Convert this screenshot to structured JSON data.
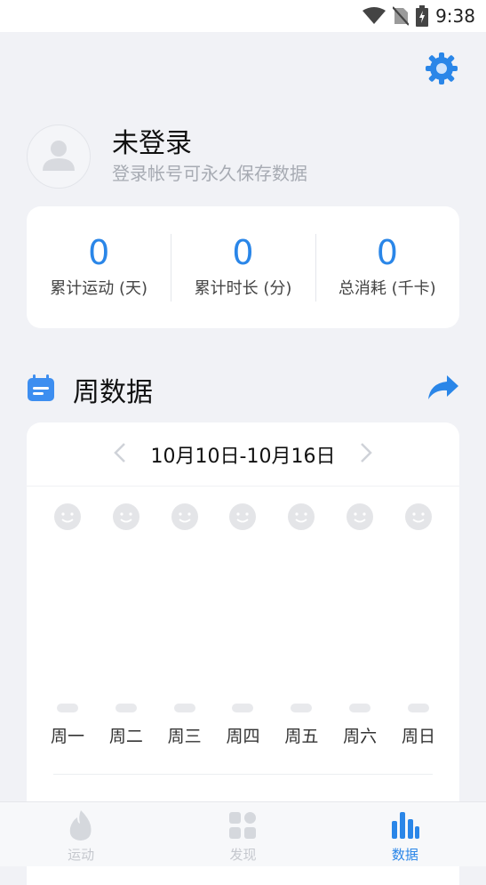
{
  "status_bar": {
    "time": "9:38",
    "icons": [
      "wifi-icon",
      "no-sim-icon",
      "battery-charging-icon"
    ]
  },
  "profile": {
    "name": "未登录",
    "subtitle": "登录帐号可永久保存数据"
  },
  "stats": [
    {
      "value": "0",
      "label": "累计运动 (天)"
    },
    {
      "value": "0",
      "label": "累计时长 (分)"
    },
    {
      "value": "0",
      "label": "总消耗 (千卡)"
    }
  ],
  "weekly": {
    "title": "周数据",
    "range": "10月10日-10月16日",
    "days": [
      "周一",
      "周二",
      "周三",
      "周四",
      "周五",
      "周六",
      "周日"
    ]
  },
  "tabs": [
    {
      "label": "运动",
      "icon": "flame-icon",
      "active": false
    },
    {
      "label": "发现",
      "icon": "grid-icon",
      "active": false
    },
    {
      "label": "数据",
      "icon": "bar-chart-icon",
      "active": true
    }
  ],
  "colors": {
    "accent": "#2a86e8",
    "background": "#f1f2f6",
    "card": "#ffffff",
    "muted": "#a7abb3",
    "inactive_tab": "#c5c8ce"
  }
}
